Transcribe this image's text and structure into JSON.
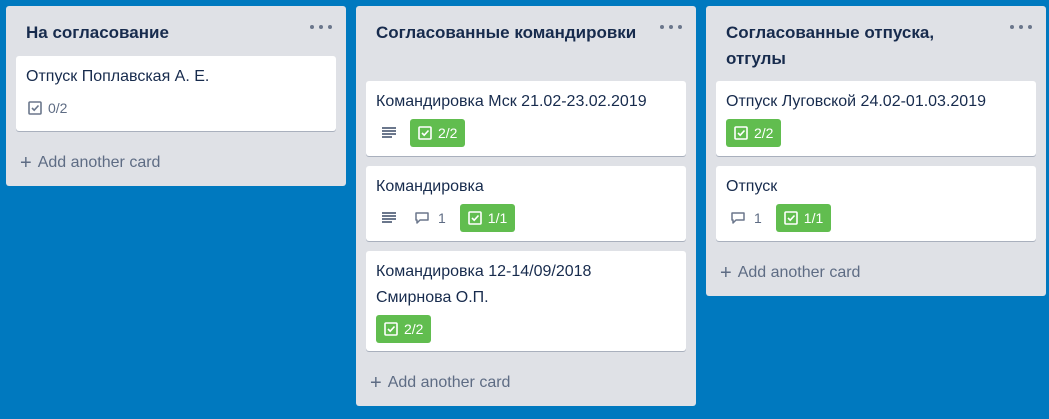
{
  "board": {
    "lists": [
      {
        "title": "На согласование",
        "cards": [
          {
            "title": "Отпуск Поплавская А. Е.",
            "checklist": "0/2"
          }
        ],
        "add_label": "Add another card"
      },
      {
        "title": "Согласованные командировки",
        "cards": [
          {
            "title": "Командировка Мск 21.02-23.02.2019",
            "checklist": "2/2"
          },
          {
            "title": "Командировка",
            "comments": "1",
            "checklist": "1/1"
          },
          {
            "title": "Командировка 12-14/09/2018 Смирнова О.П.",
            "checklist": "2/2"
          }
        ],
        "add_label": "Add another card"
      },
      {
        "title": "Согласованные отпуска, отгулы",
        "cards": [
          {
            "title": "Отпуск Луговской 24.02-01.03.2019",
            "checklist": "2/2"
          },
          {
            "title": "Отпуск",
            "comments": "1",
            "checklist": "1/1"
          }
        ],
        "add_label": "Add another card"
      }
    ]
  },
  "colors": {
    "board_background": "#0079bf",
    "list_background": "#dfe1e6",
    "checklist_complete": "#61bd4f"
  }
}
